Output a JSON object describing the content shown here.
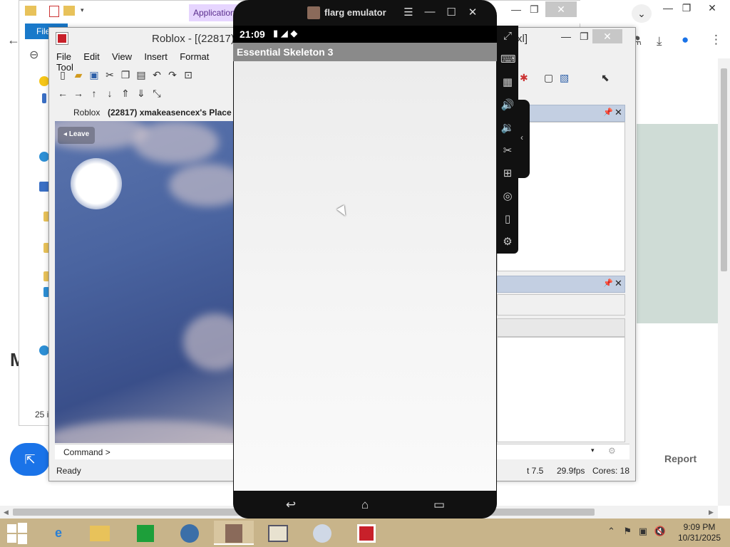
{
  "browser": {
    "report_label": "Report",
    "big_letter": "M",
    "icons": {
      "back": "back-arrow-icon",
      "labs": "flask-icon",
      "download": "download-icon",
      "profile": "profile-icon",
      "menu": "more-vert-icon"
    }
  },
  "explorer": {
    "application_tab": "Application",
    "file_tab": "File",
    "item_count": "25 it"
  },
  "studio": {
    "title": "Roblox - [(22817)",
    "title_suffix": "xl]",
    "menus": [
      "File",
      "Edit",
      "View",
      "Insert",
      "Format",
      "Tool"
    ],
    "doc_tabs": [
      "Roblox",
      "(22817) xmakeasencex's Place ("
    ],
    "leave_label": "Leave",
    "command_label": "Command >",
    "status": {
      "ready": "Ready",
      "t_value": "t 7.5",
      "fps": "29.9fps",
      "cores": "Cores: 18"
    }
  },
  "emulator": {
    "window_title": "flarg emulator",
    "time": "21:09",
    "app_title": "Essential Skeleton 3",
    "side_tools": [
      "fullscreen-icon",
      "keyboard-icon",
      "apk-icon",
      "volume-up-icon",
      "volume-down-icon",
      "scissors-icon",
      "add-window-icon",
      "location-icon",
      "vibrate-icon",
      "settings-icon"
    ]
  },
  "taskbar": {
    "time": "9:09 PM",
    "date": "10/31/2025",
    "apps": [
      "internet-explorer-icon",
      "file-explorer-icon",
      "store-icon",
      "globe-app-icon",
      "flarg-emulator-icon",
      "news-app-icon",
      "media-player-icon",
      "roblox-icon"
    ]
  },
  "colors": {
    "taskbar": "#c8b48a",
    "chrome_blue": "#1a73e8",
    "roblox_red": "#c8202a"
  }
}
